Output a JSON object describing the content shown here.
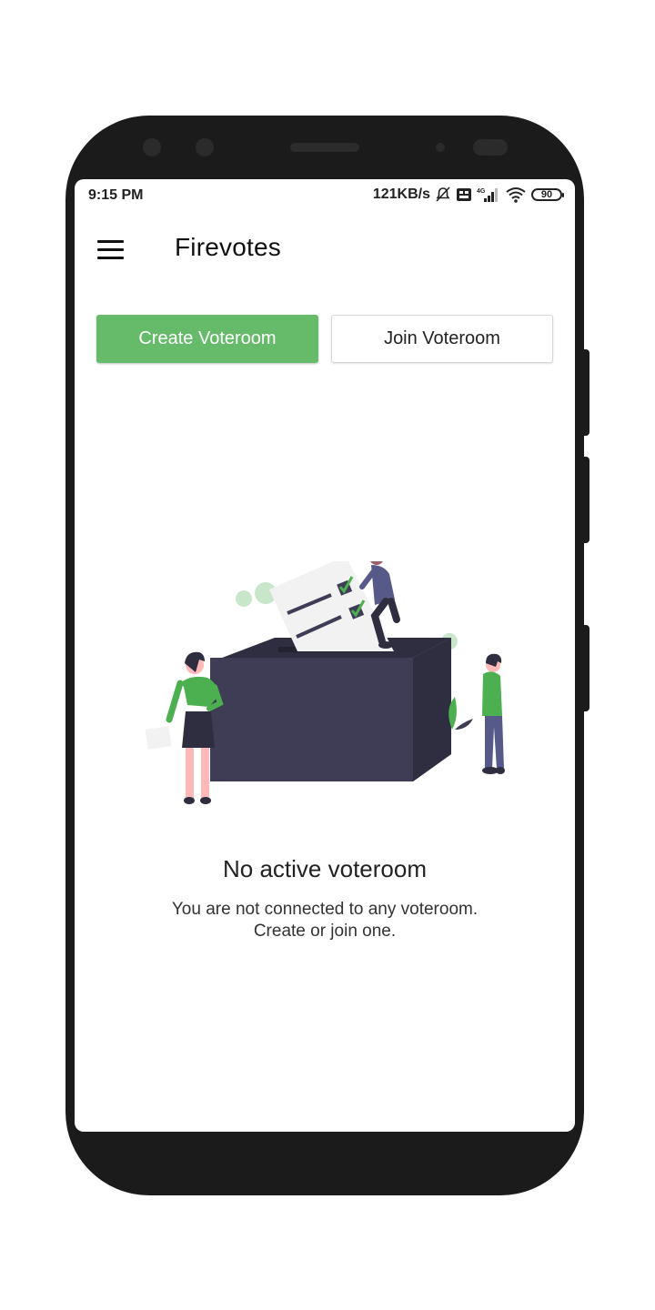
{
  "status_bar": {
    "time": "9:15 PM",
    "network_speed": "121KB/s",
    "network_type": "4G",
    "battery_level": "90",
    "icons": [
      "mute-icon",
      "volte-icon",
      "signal-icon",
      "wifi-icon",
      "battery-icon"
    ]
  },
  "app_bar": {
    "title": "Firevotes",
    "menu_icon": "hamburger-menu-icon"
  },
  "actions": {
    "create_label": "Create Voteroom",
    "join_label": "Join Voteroom"
  },
  "empty_state": {
    "title": "No active voteroom",
    "line1": "You are not connected to any voteroom.",
    "line2": "Create or join one."
  },
  "colors": {
    "primary_green": "#66bb6a",
    "ballot_box": "#3f3d56",
    "accent_green": "#4caf50",
    "frame": "#1b1b1b"
  }
}
